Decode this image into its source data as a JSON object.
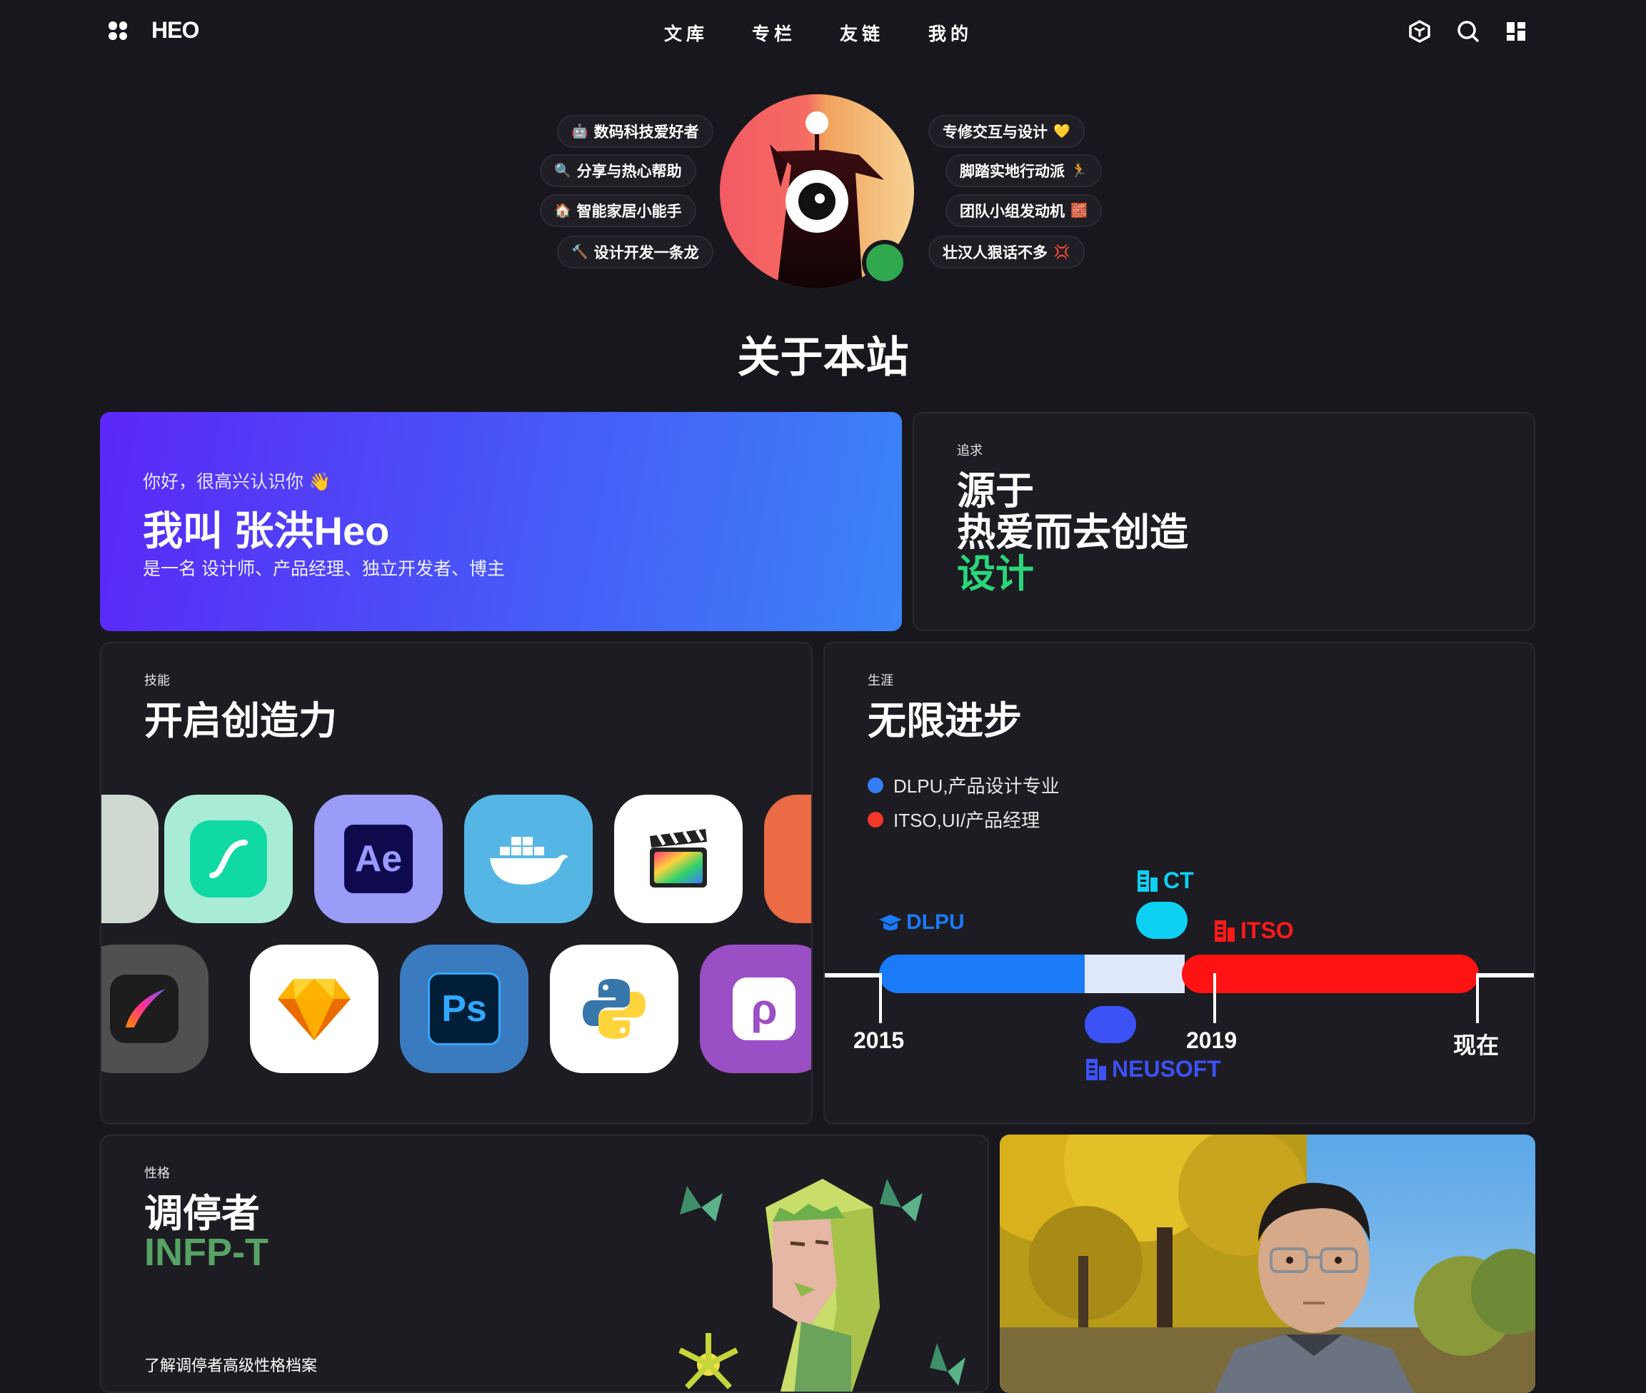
{
  "nav": {
    "logo": "HEO",
    "menu": [
      "文库",
      "专栏",
      "友链",
      "我的"
    ]
  },
  "tags": {
    "left": [
      {
        "emoji": "🤖",
        "label": "数码科技爱好者"
      },
      {
        "emoji": "🔍",
        "label": "分享与热心帮助"
      },
      {
        "emoji": "🏠",
        "label": "智能家居小能手"
      },
      {
        "emoji": "🔨",
        "label": "设计开发一条龙"
      }
    ],
    "right": [
      {
        "emoji": "💛",
        "label": "专修交互与设计"
      },
      {
        "emoji": "🏃",
        "label": "脚踏实地行动派"
      },
      {
        "emoji": "🧱",
        "label": "团队小组发动机"
      },
      {
        "emoji": "💢",
        "label": "壮汉人狠话不多"
      }
    ]
  },
  "page_title": "关于本站",
  "hello_card": {
    "greeting": "你好，很高兴认识你",
    "greeting_emoji": "👋",
    "name": "我叫 张洪Heo",
    "desc": "是一名 设计师、产品经理、独立开发者、博主"
  },
  "pursuit_card": {
    "label": "追求",
    "line1": "源于",
    "line2": "热爱而去创造",
    "line3": "设计",
    "accent": "#2bd67b"
  },
  "skills_card": {
    "label": "技能",
    "title": "开启创造力",
    "apps_row1": [
      "Ae",
      "Ps"
    ]
  },
  "career_card": {
    "label": "生涯",
    "title": "无限进步",
    "legend": [
      {
        "color": "#357ef5",
        "text": "DLPU,产品设计专业"
      },
      {
        "color": "#f3382b",
        "text": "ITSO,UI/产品经理"
      }
    ],
    "orgs": {
      "dlpu": "DLPU",
      "ct": "CT",
      "itso": "ITSO",
      "neusoft": "NEUSOFT"
    },
    "years": [
      "2015",
      "2019",
      "现在"
    ],
    "colors": {
      "dlpu": "#1a7af8",
      "ct": "#0ed0f2",
      "itso": "#ff1a1a",
      "neusoft": "#3c52f5"
    }
  },
  "personality_card": {
    "label": "性格",
    "title": "调停者",
    "type": "INFP-T",
    "type_color": "#56a364",
    "link": "了解调停者高级性格档案"
  }
}
